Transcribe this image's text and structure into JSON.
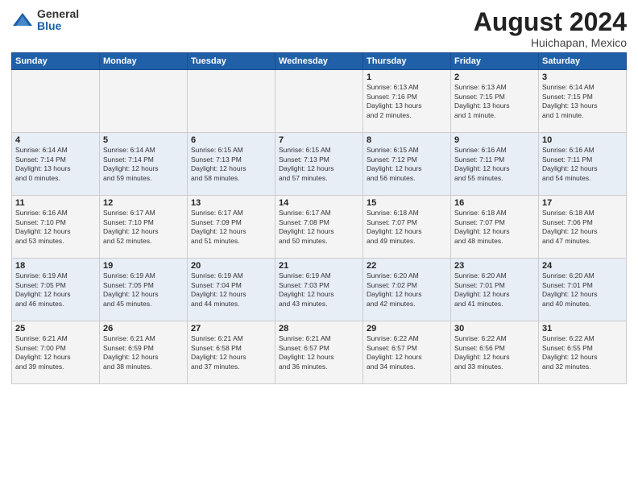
{
  "header": {
    "logo_general": "General",
    "logo_blue": "Blue",
    "month_title": "August 2024",
    "location": "Huichapan, Mexico"
  },
  "weekdays": [
    "Sunday",
    "Monday",
    "Tuesday",
    "Wednesday",
    "Thursday",
    "Friday",
    "Saturday"
  ],
  "weeks": [
    [
      {
        "day": "",
        "info": ""
      },
      {
        "day": "",
        "info": ""
      },
      {
        "day": "",
        "info": ""
      },
      {
        "day": "",
        "info": ""
      },
      {
        "day": "1",
        "info": "Sunrise: 6:13 AM\nSunset: 7:16 PM\nDaylight: 13 hours\nand 2 minutes."
      },
      {
        "day": "2",
        "info": "Sunrise: 6:13 AM\nSunset: 7:15 PM\nDaylight: 13 hours\nand 1 minute."
      },
      {
        "day": "3",
        "info": "Sunrise: 6:14 AM\nSunset: 7:15 PM\nDaylight: 13 hours\nand 1 minute."
      }
    ],
    [
      {
        "day": "4",
        "info": "Sunrise: 6:14 AM\nSunset: 7:14 PM\nDaylight: 13 hours\nand 0 minutes."
      },
      {
        "day": "5",
        "info": "Sunrise: 6:14 AM\nSunset: 7:14 PM\nDaylight: 12 hours\nand 59 minutes."
      },
      {
        "day": "6",
        "info": "Sunrise: 6:15 AM\nSunset: 7:13 PM\nDaylight: 12 hours\nand 58 minutes."
      },
      {
        "day": "7",
        "info": "Sunrise: 6:15 AM\nSunset: 7:13 PM\nDaylight: 12 hours\nand 57 minutes."
      },
      {
        "day": "8",
        "info": "Sunrise: 6:15 AM\nSunset: 7:12 PM\nDaylight: 12 hours\nand 56 minutes."
      },
      {
        "day": "9",
        "info": "Sunrise: 6:16 AM\nSunset: 7:11 PM\nDaylight: 12 hours\nand 55 minutes."
      },
      {
        "day": "10",
        "info": "Sunrise: 6:16 AM\nSunset: 7:11 PM\nDaylight: 12 hours\nand 54 minutes."
      }
    ],
    [
      {
        "day": "11",
        "info": "Sunrise: 6:16 AM\nSunset: 7:10 PM\nDaylight: 12 hours\nand 53 minutes."
      },
      {
        "day": "12",
        "info": "Sunrise: 6:17 AM\nSunset: 7:10 PM\nDaylight: 12 hours\nand 52 minutes."
      },
      {
        "day": "13",
        "info": "Sunrise: 6:17 AM\nSunset: 7:09 PM\nDaylight: 12 hours\nand 51 minutes."
      },
      {
        "day": "14",
        "info": "Sunrise: 6:17 AM\nSunset: 7:08 PM\nDaylight: 12 hours\nand 50 minutes."
      },
      {
        "day": "15",
        "info": "Sunrise: 6:18 AM\nSunset: 7:07 PM\nDaylight: 12 hours\nand 49 minutes."
      },
      {
        "day": "16",
        "info": "Sunrise: 6:18 AM\nSunset: 7:07 PM\nDaylight: 12 hours\nand 48 minutes."
      },
      {
        "day": "17",
        "info": "Sunrise: 6:18 AM\nSunset: 7:06 PM\nDaylight: 12 hours\nand 47 minutes."
      }
    ],
    [
      {
        "day": "18",
        "info": "Sunrise: 6:19 AM\nSunset: 7:05 PM\nDaylight: 12 hours\nand 46 minutes."
      },
      {
        "day": "19",
        "info": "Sunrise: 6:19 AM\nSunset: 7:05 PM\nDaylight: 12 hours\nand 45 minutes."
      },
      {
        "day": "20",
        "info": "Sunrise: 6:19 AM\nSunset: 7:04 PM\nDaylight: 12 hours\nand 44 minutes."
      },
      {
        "day": "21",
        "info": "Sunrise: 6:19 AM\nSunset: 7:03 PM\nDaylight: 12 hours\nand 43 minutes."
      },
      {
        "day": "22",
        "info": "Sunrise: 6:20 AM\nSunset: 7:02 PM\nDaylight: 12 hours\nand 42 minutes."
      },
      {
        "day": "23",
        "info": "Sunrise: 6:20 AM\nSunset: 7:01 PM\nDaylight: 12 hours\nand 41 minutes."
      },
      {
        "day": "24",
        "info": "Sunrise: 6:20 AM\nSunset: 7:01 PM\nDaylight: 12 hours\nand 40 minutes."
      }
    ],
    [
      {
        "day": "25",
        "info": "Sunrise: 6:21 AM\nSunset: 7:00 PM\nDaylight: 12 hours\nand 39 minutes."
      },
      {
        "day": "26",
        "info": "Sunrise: 6:21 AM\nSunset: 6:59 PM\nDaylight: 12 hours\nand 38 minutes."
      },
      {
        "day": "27",
        "info": "Sunrise: 6:21 AM\nSunset: 6:58 PM\nDaylight: 12 hours\nand 37 minutes."
      },
      {
        "day": "28",
        "info": "Sunrise: 6:21 AM\nSunset: 6:57 PM\nDaylight: 12 hours\nand 36 minutes."
      },
      {
        "day": "29",
        "info": "Sunrise: 6:22 AM\nSunset: 6:57 PM\nDaylight: 12 hours\nand 34 minutes."
      },
      {
        "day": "30",
        "info": "Sunrise: 6:22 AM\nSunset: 6:56 PM\nDaylight: 12 hours\nand 33 minutes."
      },
      {
        "day": "31",
        "info": "Sunrise: 6:22 AM\nSunset: 6:55 PM\nDaylight: 12 hours\nand 32 minutes."
      }
    ]
  ]
}
